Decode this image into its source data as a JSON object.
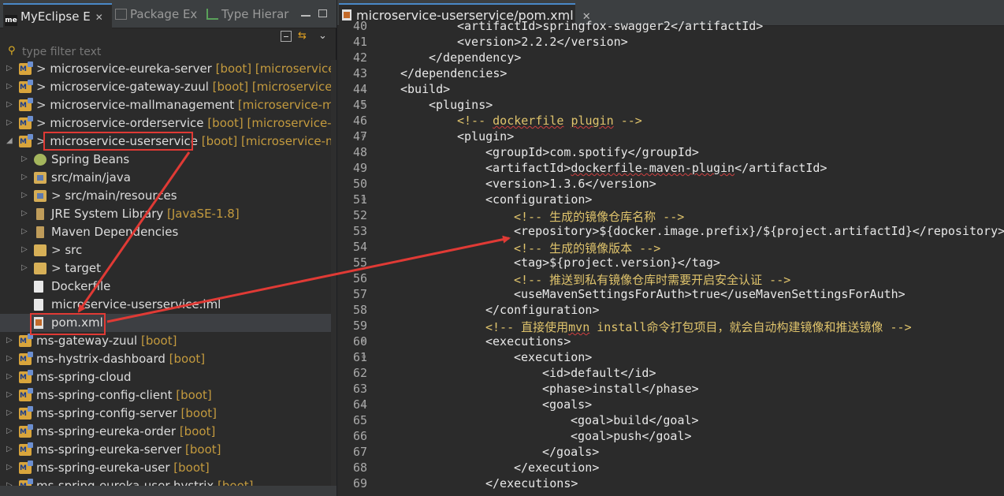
{
  "left_panel": {
    "tabs": [
      {
        "label": "MyEclipse E",
        "icon_text": "me",
        "active": true
      },
      {
        "label": "Package Ex",
        "active": false
      },
      {
        "label": "Type Hierar",
        "active": false
      }
    ],
    "filter_placeholder": "type filter text",
    "tree": [
      {
        "expander": "▷",
        "icon": "project-icon",
        "pre": "> ",
        "name": "microservice-eureka-server",
        "deco": " [boot] [microservice-",
        "indent": 0
      },
      {
        "expander": "▷",
        "icon": "project-icon",
        "pre": "> ",
        "name": "microservice-gateway-zuul",
        "deco": " [boot] [microservice-r",
        "indent": 0
      },
      {
        "expander": "▷",
        "icon": "project-icon",
        "pre": "> ",
        "name": "microservice-mallmanagement",
        "deco": " [microservice-mal",
        "indent": 0
      },
      {
        "expander": "▷",
        "icon": "project-icon",
        "pre": "> ",
        "name": "microservice-orderservice",
        "deco": " [boot] [microservice-m",
        "indent": 0
      },
      {
        "expander": "◢",
        "icon": "project-icon",
        "pre": "> ",
        "name": "microservice-userservice",
        "deco": " [boot] [microservice-ma",
        "indent": 0
      },
      {
        "expander": "▷",
        "icon": "beans-icon",
        "pre": "",
        "name": "Spring Beans",
        "deco": "",
        "indent": 1
      },
      {
        "expander": "▷",
        "icon": "source-folder-icon",
        "pre": "",
        "name": "src/main/java",
        "deco": "",
        "indent": 1
      },
      {
        "expander": "▷",
        "icon": "source-folder-icon",
        "pre": "> ",
        "name": "src/main/resources",
        "deco": "",
        "indent": 1
      },
      {
        "expander": "▷",
        "icon": "library-icon",
        "pre": "",
        "name": "JRE System Library",
        "deco": " [JavaSE-1.8]",
        "indent": 1
      },
      {
        "expander": "▷",
        "icon": "library-icon",
        "pre": "",
        "name": "Maven Dependencies",
        "deco": "",
        "indent": 1
      },
      {
        "expander": "▷",
        "icon": "folder-icon",
        "pre": "> ",
        "name": "src",
        "deco": "",
        "indent": 1
      },
      {
        "expander": "▷",
        "icon": "folder-icon",
        "pre": "> ",
        "name": "target",
        "deco": "",
        "indent": 1
      },
      {
        "expander": "",
        "icon": "file-icon",
        "pre": "",
        "name": "Dockerfile",
        "deco": "",
        "indent": 1
      },
      {
        "expander": "",
        "icon": "file-icon",
        "pre": "",
        "name": "microservice-userservice.iml",
        "deco": "",
        "indent": 1
      },
      {
        "expander": "",
        "icon": "xml-file-icon",
        "pre": "",
        "name": "pom.xml",
        "deco": "",
        "indent": 1,
        "selected": true
      },
      {
        "expander": "▷",
        "icon": "project-icon",
        "pre": "",
        "name": "ms-gateway-zuul",
        "deco": " [boot]",
        "indent": 0
      },
      {
        "expander": "▷",
        "icon": "project-icon",
        "pre": "",
        "name": "ms-hystrix-dashboard",
        "deco": " [boot]",
        "indent": 0
      },
      {
        "expander": "▷",
        "icon": "project-icon",
        "pre": "",
        "name": "ms-spring-cloud",
        "deco": "",
        "indent": 0
      },
      {
        "expander": "▷",
        "icon": "project-icon",
        "pre": "",
        "name": "ms-spring-config-client",
        "deco": " [boot]",
        "indent": 0
      },
      {
        "expander": "▷",
        "icon": "project-icon",
        "pre": "",
        "name": "ms-spring-config-server",
        "deco": " [boot]",
        "indent": 0
      },
      {
        "expander": "▷",
        "icon": "project-icon",
        "pre": "",
        "name": "ms-spring-eureka-order",
        "deco": " [boot]",
        "indent": 0
      },
      {
        "expander": "▷",
        "icon": "project-icon",
        "pre": "",
        "name": "ms-spring-eureka-server",
        "deco": " [boot]",
        "indent": 0
      },
      {
        "expander": "▷",
        "icon": "project-icon",
        "pre": "",
        "name": "ms-spring-eureka-user",
        "deco": " [boot]",
        "indent": 0
      },
      {
        "expander": "▷",
        "icon": "project-icon",
        "pre": "",
        "name": "ms-spring-eureka-user-hystrix",
        "deco": " [boot]",
        "indent": 0
      }
    ]
  },
  "editor": {
    "tab_label": "microservice-userservice/pom.xml",
    "lines": [
      {
        "n": "40",
        "fold": "",
        "ind": 3,
        "segs": [
          [
            "tg",
            "<artifactId>"
          ],
          [
            "t",
            "springfox-swagger2"
          ],
          [
            "tg",
            "</artifactId>"
          ]
        ]
      },
      {
        "n": "41",
        "fold": "",
        "ind": 3,
        "segs": [
          [
            "tg",
            "<version>"
          ],
          [
            "t",
            "2.2.2"
          ],
          [
            "tg",
            "</version>"
          ]
        ]
      },
      {
        "n": "42",
        "fold": "",
        "ind": 2,
        "segs": [
          [
            "tg",
            "</dependency>"
          ]
        ]
      },
      {
        "n": "43",
        "fold": "",
        "ind": 1,
        "segs": [
          [
            "tg",
            "</dependencies>"
          ]
        ]
      },
      {
        "n": "44",
        "fold": "⊖",
        "ind": 1,
        "segs": [
          [
            "tg",
            "<build>"
          ]
        ]
      },
      {
        "n": "45",
        "fold": "⊖",
        "ind": 2,
        "segs": [
          [
            "tg",
            "<plugins>"
          ]
        ]
      },
      {
        "n": "46",
        "fold": "",
        "ind": 3,
        "segs": [
          [
            "cm",
            "<!-- "
          ],
          [
            "cmw",
            "dockerfile"
          ],
          [
            "cm",
            " "
          ],
          [
            "cmw",
            "plugin"
          ],
          [
            "cm",
            " -->"
          ]
        ]
      },
      {
        "n": "47",
        "fold": "⊖",
        "ind": 3,
        "segs": [
          [
            "tg",
            "<plugin>"
          ]
        ]
      },
      {
        "n": "48",
        "fold": "",
        "ind": 4,
        "segs": [
          [
            "tg",
            "<groupId>"
          ],
          [
            "t",
            "com.spotify"
          ],
          [
            "tg",
            "</groupId>"
          ]
        ]
      },
      {
        "n": "49",
        "fold": "",
        "ind": 4,
        "segs": [
          [
            "tg",
            "<artifactId>"
          ],
          [
            "tw",
            "dockerfile-maven-plugin"
          ],
          [
            "tg",
            "</artifactId>"
          ]
        ]
      },
      {
        "n": "50",
        "fold": "",
        "ind": 4,
        "segs": [
          [
            "tg",
            "<version>"
          ],
          [
            "t",
            "1.3.6"
          ],
          [
            "tg",
            "</version>"
          ]
        ]
      },
      {
        "n": "51",
        "fold": "⊖",
        "ind": 4,
        "segs": [
          [
            "tg",
            "<configuration>"
          ]
        ]
      },
      {
        "n": "52",
        "fold": "",
        "ind": 5,
        "segs": [
          [
            "cm",
            "<!-- 生成的镜像仓库名称 -->"
          ]
        ]
      },
      {
        "n": "53",
        "fold": "",
        "ind": 5,
        "segs": [
          [
            "tg",
            "<repository>"
          ],
          [
            "t",
            "${docker.image.prefix}/${project.artifactId}"
          ],
          [
            "tg",
            "</repository>"
          ]
        ]
      },
      {
        "n": "54",
        "fold": "",
        "ind": 5,
        "segs": [
          [
            "cm",
            "<!-- 生成的镜像版本 -->"
          ]
        ]
      },
      {
        "n": "55",
        "fold": "",
        "ind": 5,
        "segs": [
          [
            "tg",
            "<tag>"
          ],
          [
            "t",
            "${project.version}"
          ],
          [
            "tg",
            "</tag>"
          ]
        ]
      },
      {
        "n": "56",
        "fold": "",
        "ind": 5,
        "segs": [
          [
            "cm",
            "<!-- 推送到私有镜像仓库时需要开启安全认证 -->"
          ]
        ]
      },
      {
        "n": "57",
        "fold": "",
        "ind": 5,
        "segs": [
          [
            "tg",
            "<useMavenSettingsForAuth>"
          ],
          [
            "t",
            "true"
          ],
          [
            "tg",
            "</useMavenSettingsForAuth>"
          ]
        ]
      },
      {
        "n": "58",
        "fold": "",
        "ind": 4,
        "segs": [
          [
            "tg",
            "</configuration>"
          ]
        ]
      },
      {
        "n": "59",
        "fold": "",
        "ind": 4,
        "segs": [
          [
            "cm",
            "<!-- 直接使用"
          ],
          [
            "cmw",
            "mvn"
          ],
          [
            "cm",
            " install命令打包项目，就会自动构建镜像和推送镜像 -->"
          ]
        ]
      },
      {
        "n": "60",
        "fold": "⊖",
        "ind": 4,
        "segs": [
          [
            "tg",
            "<executions>"
          ]
        ]
      },
      {
        "n": "61",
        "fold": "⊖",
        "ind": 5,
        "segs": [
          [
            "tg",
            "<execution>"
          ]
        ]
      },
      {
        "n": "62",
        "fold": "",
        "ind": 6,
        "segs": [
          [
            "tg",
            "<id>"
          ],
          [
            "t",
            "default"
          ],
          [
            "tg",
            "</id>"
          ]
        ]
      },
      {
        "n": "63",
        "fold": "",
        "ind": 6,
        "segs": [
          [
            "tg",
            "<phase>"
          ],
          [
            "t",
            "install"
          ],
          [
            "tg",
            "</phase>"
          ]
        ]
      },
      {
        "n": "64",
        "fold": "⊖",
        "ind": 6,
        "segs": [
          [
            "tg",
            "<goals>"
          ]
        ]
      },
      {
        "n": "65",
        "fold": "",
        "ind": 7,
        "segs": [
          [
            "tg",
            "<goal>"
          ],
          [
            "t",
            "build"
          ],
          [
            "tg",
            "</goal>"
          ]
        ]
      },
      {
        "n": "66",
        "fold": "",
        "ind": 7,
        "segs": [
          [
            "tg",
            "<goal>"
          ],
          [
            "t",
            "push"
          ],
          [
            "tg",
            "</goal>"
          ]
        ]
      },
      {
        "n": "67",
        "fold": "",
        "ind": 6,
        "segs": [
          [
            "tg",
            "</goals>"
          ]
        ]
      },
      {
        "n": "68",
        "fold": "",
        "ind": 5,
        "segs": [
          [
            "tg",
            "</execution>"
          ]
        ]
      },
      {
        "n": "69",
        "fold": "",
        "ind": 4,
        "segs": [
          [
            "tg",
            "</executions>"
          ]
        ]
      }
    ]
  },
  "colors": {
    "highlight_box": "#e03a35",
    "comment": "#e0c46c",
    "decoration": "#c39a3e",
    "active_tab_accent": "#4a88c7"
  }
}
